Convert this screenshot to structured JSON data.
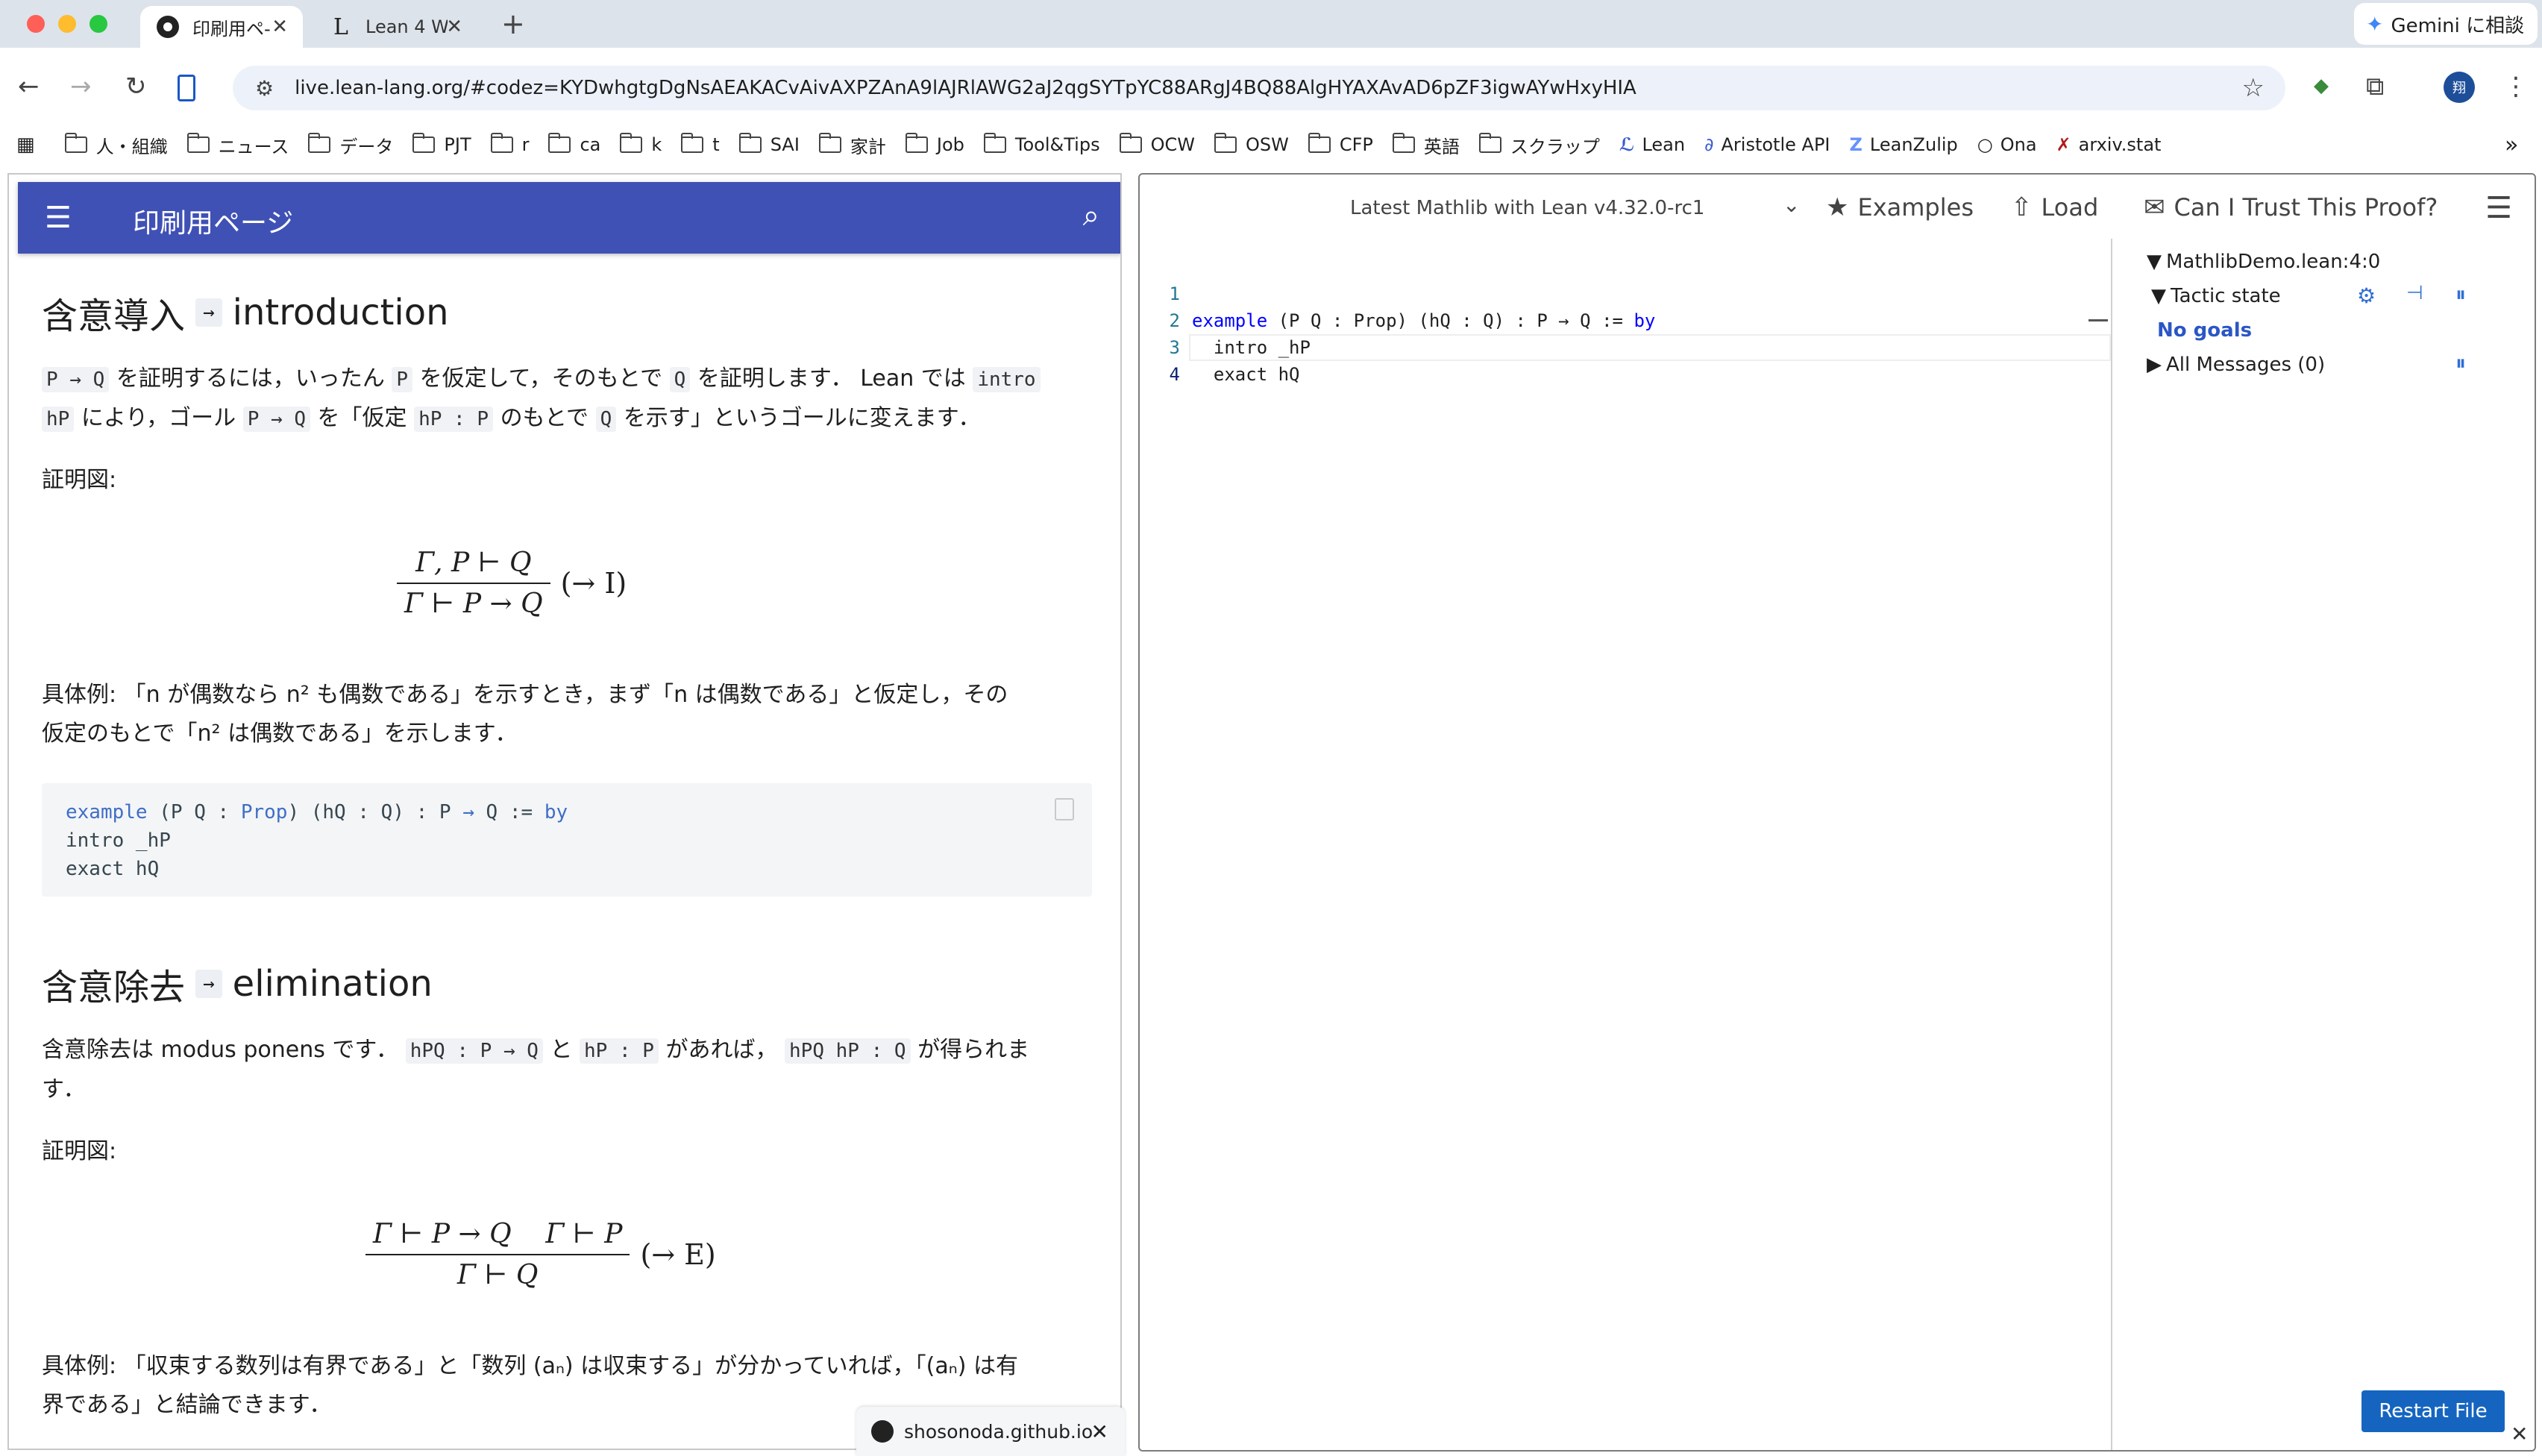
{
  "browser": {
    "tabs": [
      {
        "title": "印刷用ペ-",
        "active": true
      },
      {
        "title": "Lean 4 W",
        "active": false
      }
    ],
    "gemini_label": "Gemini に相談",
    "url": "live.lean-lang.org/#codez=KYDwhgtgDgNsAEAKACvAivAXPZAnA9lAJRlAWG2aJ2qgSYTpYC88ARgJ4BQ88AlgHYAXAvAD6pZF3igwAYwHxyHIA",
    "bookmarks": [
      "人・組織",
      "ニュース",
      "データ",
      "PJT",
      "r",
      "ca",
      "k",
      "t",
      "SAI",
      "家計",
      "Job",
      "Tool&Tips",
      "OCW",
      "OSW",
      "CFP",
      "英語",
      "スクラップ",
      "Lean",
      "Aristotle API",
      "LeanZulip",
      "Ona",
      "arxiv.stat"
    ],
    "bookmarks_more": "»"
  },
  "doc": {
    "app_title": "印刷用ページ",
    "sec1": {
      "heading_jp": "含意導入",
      "heading_sym": "→",
      "heading_en": "introduction",
      "p1_a": "P → Q",
      "p1_b": "を証明するには，いったん",
      "p1_c": "P",
      "p1_d": "を仮定して，そのもとで",
      "p1_e": "Q",
      "p1_f": "を証明します．",
      "p1_g": "Lean では",
      "p1_h": "intro",
      "p1_i": "hP",
      "p1_j": "により，ゴール",
      "p1_k": "P → Q",
      "p1_l": "を「仮定",
      "p1_m": "hP : P",
      "p1_n": "のもとで",
      "p1_o": "Q",
      "p1_p": "を示す」というゴールに変えます．",
      "diagram_label": "証明図:",
      "rule_num": "Γ, P ⊢ Q",
      "rule_den": "Γ ⊢ P → Q",
      "rule_name": "(→ I)",
      "ex_line1": "具体例: 「n が偶数なら n² も偶数である」を示すとき，まず「n は偶数である」と仮定し，その",
      "ex_line2": "仮定のもとで「n² は偶数である」を示します．",
      "code": [
        "example (P Q : Prop) (hQ : Q) : P → Q := by",
        "  intro _hP",
        "  exact hQ"
      ]
    },
    "sec2": {
      "heading_jp": "含意除去",
      "heading_sym": "→",
      "heading_en": "elimination",
      "p_a": "含意除去は modus ponens です．",
      "p_b": "hPQ : P → Q",
      "p_c": "と",
      "p_d": "hP : P",
      "p_e": "があれば，",
      "p_f": "hPQ hP : Q",
      "p_g": "が得られま",
      "p_h": "す．",
      "diagram_label": "証明図:",
      "rule_num": "Γ ⊢ P → Q    Γ ⊢ P",
      "rule_den": "Γ ⊢ Q",
      "rule_name": "(→ E)",
      "ex_line1": "具体例: 「収束する数列は有界である」と「数列 (aₙ) は収束する」が分かっていれば，「(aₙ) は有",
      "ex_line2": "界である」と結論できます．"
    },
    "snackbar": "shosonoda.github.io"
  },
  "editor": {
    "version": "Latest Mathlib with Lean v4.32.0-rc1",
    "examples": "Examples",
    "load": "Load",
    "trust": "Can I Trust This Proof?",
    "lines": [
      {
        "n": "1",
        "kw": "example",
        "rest": " (P Q : Prop) (hQ : Q) : P → Q := ",
        "kw2": "by"
      },
      {
        "n": "2",
        "kw": "",
        "rest": "  intro _hP",
        "kw2": ""
      },
      {
        "n": "3",
        "kw": "",
        "rest": "  exact hQ",
        "kw2": ""
      },
      {
        "n": "4",
        "kw": "",
        "rest": "",
        "kw2": ""
      }
    ],
    "infoview": {
      "file": "MathlibDemo.lean:4:0",
      "tactic_state": "Tactic state",
      "no_goals": "No goals",
      "all_messages": "All Messages (0)"
    },
    "restart": "Restart File"
  }
}
